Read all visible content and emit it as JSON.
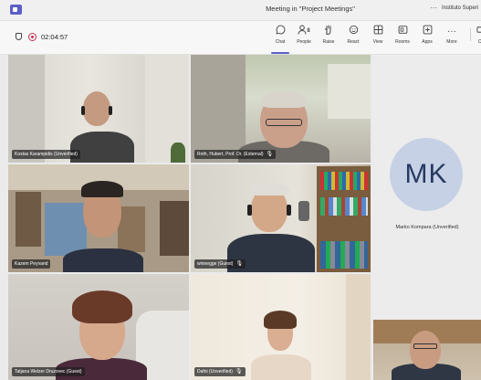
{
  "window": {
    "title": "Meeting in \"Project Meetings\"",
    "more": "···",
    "org": "Instituto Superi"
  },
  "toolbar": {
    "timer": "02:04:57",
    "buttons": [
      {
        "label": "Chat",
        "icon": "chat-icon"
      },
      {
        "label": "People",
        "icon": "people-icon",
        "count": "8"
      },
      {
        "label": "Raise",
        "icon": "raise-hand-icon"
      },
      {
        "label": "React",
        "icon": "react-icon"
      },
      {
        "label": "View",
        "icon": "view-icon"
      },
      {
        "label": "Rooms",
        "icon": "rooms-icon"
      },
      {
        "label": "Apps",
        "icon": "apps-icon"
      },
      {
        "label": "More",
        "icon": "more-icon"
      },
      {
        "label": "Ca",
        "icon": "camera-icon"
      }
    ]
  },
  "participants": [
    {
      "name": "Kostas Karampidis (Unverified)",
      "muted": false
    },
    {
      "name": "Roth, Hubert, Prof. Dr. (External)",
      "muted": true
    },
    {
      "name": "Kazem Peyvand",
      "muted": false
    },
    {
      "name": "winnegge (Guest)",
      "muted": true
    },
    {
      "name": "Tatjana Welzer Druzovec (Guest)",
      "muted": false
    },
    {
      "name": "Dafni (Unverified)",
      "muted": true
    }
  ],
  "avatar_participant": {
    "initials": "MK",
    "name": "Marko Kompara (Unverified)"
  },
  "colors": {
    "accent": "#5b5fc7",
    "record": "#c4314b",
    "avatar_bg": "#c6d1e5",
    "avatar_text": "#273a62"
  }
}
